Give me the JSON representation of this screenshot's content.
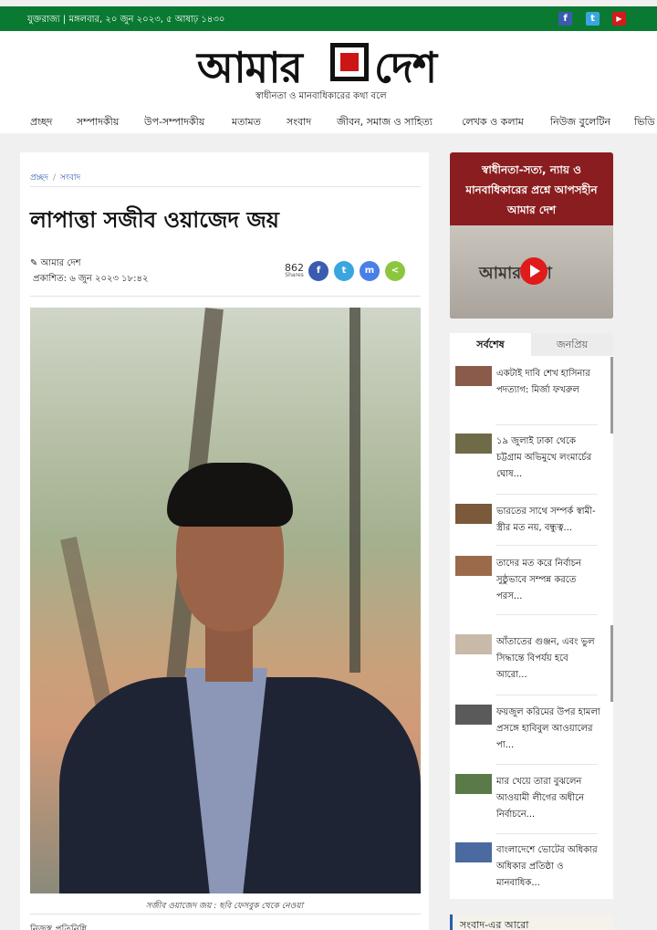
{
  "topbar": {
    "date": "যুক্তরাজ্য | মঙ্গলবার, ২০ জুন ২০২৩, ৫ আষাঢ় ১৪৩০",
    "facebook": "f",
    "twitter": "t",
    "youtube": "▶"
  },
  "header": {
    "logo_left": "আমার",
    "logo_right": "দেশ",
    "tagline": "স্বাধীনতা ও মানবাধিকারের কথা বলে"
  },
  "nav": [
    "প্রচ্ছদ",
    "সম্পাদকীয়",
    "উপ-সম্পাদকীয়",
    "মতামত",
    "সংবাদ",
    "জীবন, সমাজ ও সাহিত্য",
    "লেখক ও কলাম",
    "নিউজ বুলেটিন",
    "ভিডি"
  ],
  "article": {
    "breadcrumb": [
      "প্রচ্ছদ",
      "সংবাদ"
    ],
    "breadcrumb_sep": "/",
    "title": "লাপাত্তা সজীব ওয়াজেদ জয়",
    "author": "✎ আমার দেশ",
    "published": "প্রকাশিত: ৬ জুন ২০২৩ ১৮:৪২",
    "shares_count": "862",
    "shares_label": "Shares",
    "share_icons": [
      "f",
      "t",
      "m",
      "<"
    ],
    "caption": "সজীব ওয়াজেদ জয় : ছবি ফেসবুক থেকে নেওয়া",
    "cut_text": "নিজস্ব প্রতিনিধি"
  },
  "video": {
    "text": "স্বাধীনতা-সত্য, ন্যায় ও মানবাধিকারের প্রশ্নে আপসহীন আমার দেশ",
    "thumb_logo": "আমার দেশ"
  },
  "sidebar": {
    "tab_latest": "সর্বশেষ",
    "tab_popular": "জনপ্রিয়",
    "items": [
      "একটাই দাবি শেখ হাসিনার পদত্যাগ: মির্জা ফখরুল",
      "১৯ জুলাই ঢাকা থেকে চট্টগ্রাম অভিমুখে লংমার্চের ঘোষ...",
      "ভারতের সাথে সম্পর্ক স্বামী-স্ত্রীর মত নয়, বন্ধুত্ব...",
      "তাদের মত করে নির্বাচন সুষ্ঠুভাবে সম্পন্ন করতে পরস...",
      "আঁতাতের গুঞ্জন, এবং ভুল সিদ্ধান্তে বিপর্যয় হবে আরো...",
      "ফয়জুল করিমের উপর হামলা প্রসঙ্গে হাবিবুল আওয়ালের পা...",
      "মার খেয়ে তারা বুঝলেন আওয়ামী লীগের অধীনে নির্বাচনে...",
      "বাংলাদেশে ভোটের অধিকার অধিকার প্রতিষ্ঠা ও মানবাধিক..."
    ],
    "more_title": "সংবাদ-এর আরো"
  }
}
